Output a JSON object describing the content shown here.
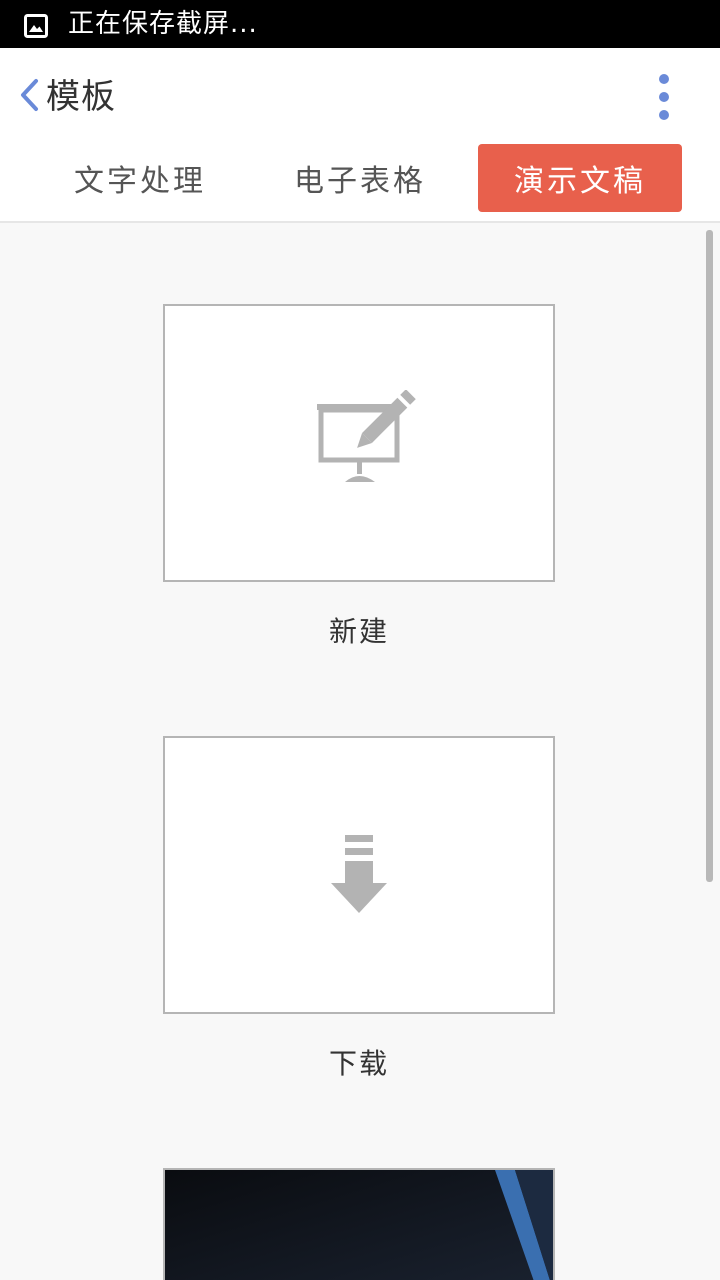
{
  "status_bar": {
    "icon": "image-icon",
    "text": "正在保存截屏..."
  },
  "app_bar": {
    "title": "模板",
    "back_icon": "chevron-left-icon",
    "more_icon": "more-vertical-icon",
    "accent_color": "#6a8ad8"
  },
  "tabs": [
    {
      "label": "文字处理",
      "active": false
    },
    {
      "label": "电子表格",
      "active": false
    },
    {
      "label": "演示文稿",
      "active": true
    }
  ],
  "active_tab_color": "#e8604c",
  "templates": [
    {
      "label": "新建",
      "icon": "presentation-edit-icon"
    },
    {
      "label": "下载",
      "icon": "download-arrow-icon"
    }
  ]
}
